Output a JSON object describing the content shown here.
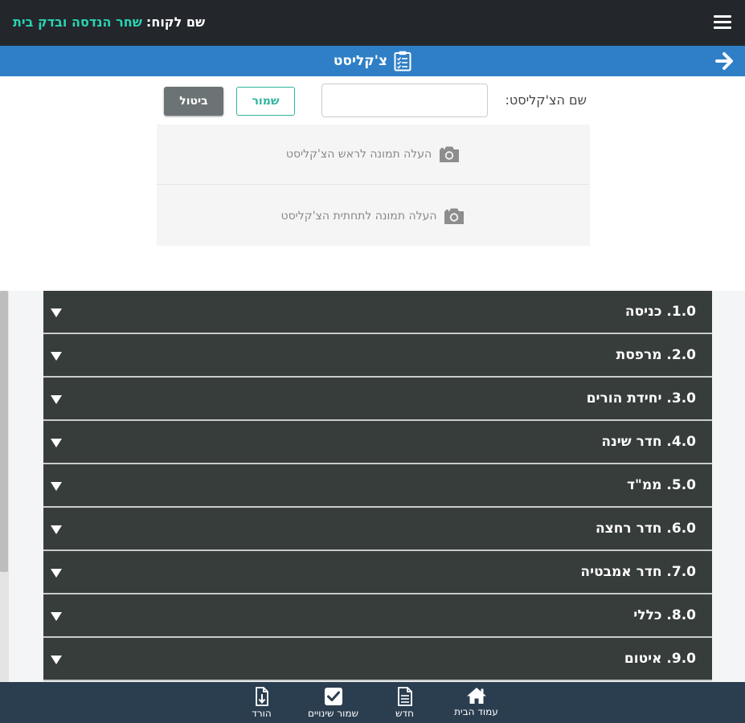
{
  "header": {
    "customer_label": "שם לקוח:",
    "customer_value": "שחר הנדסה ובדק בית"
  },
  "titlebar": {
    "title": "צ'קליסט"
  },
  "form": {
    "name_label": "שם הצ'קליסט:",
    "name_value": "",
    "save_label": "שמור",
    "cancel_label": "ביטול"
  },
  "upload": {
    "top_text": "העלה תמונה לראש הצ'קליסט",
    "bottom_text": "העלה תמונה לתחתית הצ'קליסט"
  },
  "categories": [
    "1.0. כניסה",
    "2.0. מרפסת",
    "3.0. יחידת הורים",
    "4.0. חדר שינה",
    "5.0. ממ\"ד",
    "6.0. חדר רחצה",
    "7.0. חדר אמבטיה",
    "8.0. כללי",
    "9.0. איטום"
  ],
  "bottom_nav": {
    "home": "עמוד הבית",
    "new": "חדש",
    "save_changes": "שמור שינויים",
    "download": "הורד"
  },
  "colors": {
    "header_bg": "#23272b",
    "title_bg": "#2f7fc6",
    "accent": "#29d3b3",
    "category_bg": "#373d3b",
    "bottom_bg": "#2b3e50"
  }
}
